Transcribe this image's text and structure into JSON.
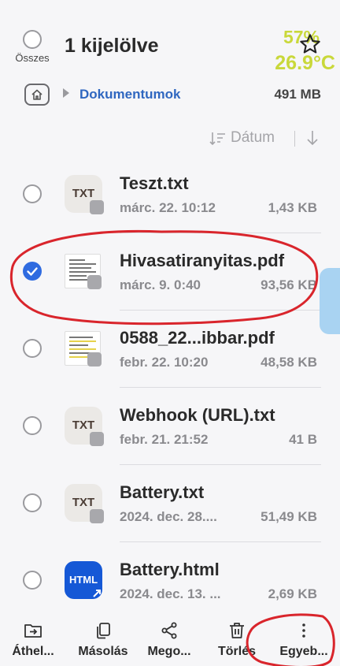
{
  "header": {
    "select_all_label": "Összes",
    "title": "1 kijelölve"
  },
  "overlay": {
    "battery": "57%",
    "temperature": "26.9°C",
    "color": "#c9d83a"
  },
  "path": {
    "folder": "Dokumentumok",
    "storage_size": "491 MB"
  },
  "sort": {
    "label": "Dátum"
  },
  "files": [
    {
      "name": "Teszt.txt",
      "date": "márc. 22. 10:12",
      "size": "1,43 KB",
      "type": "TXT",
      "selected": false
    },
    {
      "name": "Hivasatiranyitas.pdf",
      "date": "márc. 9. 0:40",
      "size": "93,56 KB",
      "type": "pdf",
      "selected": true
    },
    {
      "name": "0588_22...ibbar.pdf",
      "date": "febr. 22. 10:20",
      "size": "48,58 KB",
      "type": "pdf",
      "selected": false
    },
    {
      "name": "Webhook (URL).txt",
      "date": "febr. 21. 21:52",
      "size": "41 B",
      "type": "TXT",
      "selected": false
    },
    {
      "name": "Battery.txt",
      "date": "2024. dec. 28....",
      "size": "51,49 KB",
      "type": "TXT",
      "selected": false
    },
    {
      "name": "Battery.html",
      "date": "2024. dec. 13. ...",
      "size": "2,69 KB",
      "type": "HTML",
      "selected": false
    }
  ],
  "actions": {
    "move": "Áthel...",
    "copy": "Másolás",
    "share": "Mego...",
    "delete": "Törlés",
    "more": "Egyeb..."
  },
  "colors": {
    "accent": "#2f6be0",
    "link": "#2f67c0",
    "annotation": "#d9252c",
    "scroll_handle": "#a9d3f2"
  }
}
